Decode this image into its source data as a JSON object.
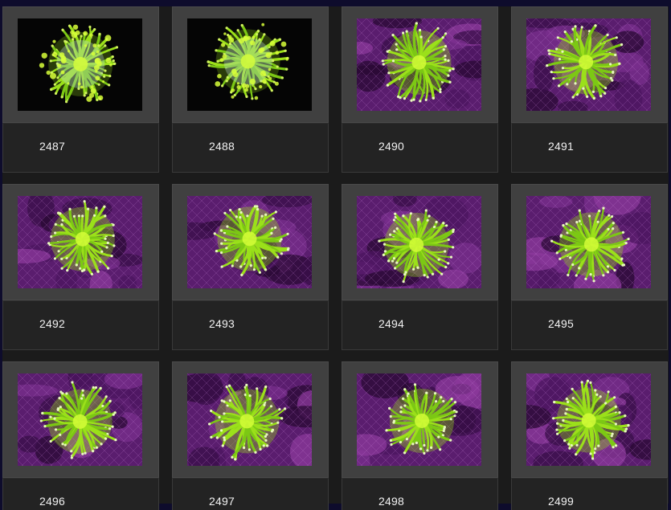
{
  "gallery": {
    "items": [
      {
        "label": "2487",
        "style": "black"
      },
      {
        "label": "2488",
        "style": "black"
      },
      {
        "label": "2490",
        "style": "purple"
      },
      {
        "label": "2491",
        "style": "purple"
      },
      {
        "label": "2492",
        "style": "purple"
      },
      {
        "label": "2493",
        "style": "purple"
      },
      {
        "label": "2494",
        "style": "purple"
      },
      {
        "label": "2495",
        "style": "purple"
      },
      {
        "label": "2496",
        "style": "purple"
      },
      {
        "label": "2497",
        "style": "purple"
      },
      {
        "label": "2498",
        "style": "purple"
      },
      {
        "label": "2499",
        "style": "purple"
      }
    ]
  },
  "colors": {
    "page_bg": "#1b1b1b",
    "border": "#0e0c2c",
    "thumb_frame": "#404040",
    "caption_bg": "#232323",
    "caption_text": "#f2f2f2",
    "coral_green": "#9be01a",
    "coral_bright": "#d8ff3a",
    "rock_purple": "#5a1d6e",
    "water_black": "#050505"
  }
}
